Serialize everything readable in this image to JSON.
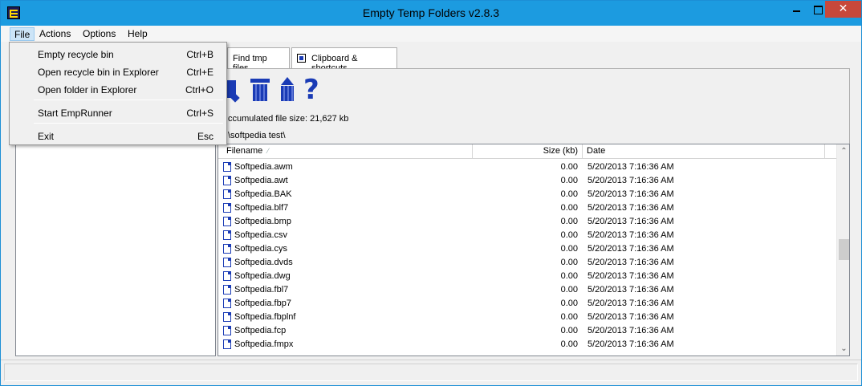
{
  "window": {
    "title": "Empty Temp Folders v2.8.3",
    "close_glyph": "✕",
    "accent_color": "#1c9be0",
    "close_color": "#c7483b"
  },
  "menubar": {
    "file": "File",
    "actions": "Actions",
    "options": "Options",
    "help": "Help"
  },
  "file_menu": {
    "items": [
      {
        "label": "Empty recycle bin",
        "shortcut": "Ctrl+B"
      },
      {
        "label": "Open recycle bin in Explorer",
        "shortcut": "Ctrl+E"
      },
      {
        "label": "Open folder in Explorer",
        "shortcut": "Ctrl+O"
      },
      {
        "label": "Start EmpRunner",
        "shortcut": "Ctrl+S"
      },
      {
        "label": "Exit",
        "shortcut": "Esc"
      }
    ]
  },
  "tabs": {
    "find": "Find tmp files",
    "clipboard": "Clipboard & shortcuts"
  },
  "toolbar": {
    "help_glyph": "?",
    "icons": [
      "find-icon",
      "trash-icon",
      "upload-icon",
      "help-icon"
    ]
  },
  "info": {
    "accumulated": "ccumulated file size: 21,627 kb",
    "path": "\\softpedia test\\"
  },
  "list": {
    "headers": {
      "name": "Filename",
      "size": "Size (kb)",
      "date": "Date",
      "sort_glyph": "⁄"
    },
    "rows": [
      {
        "name": "Softpedia.awm",
        "size": "0.00",
        "date": "5/20/2013 7:16:36 AM"
      },
      {
        "name": "Softpedia.awt",
        "size": "0.00",
        "date": "5/20/2013 7:16:36 AM"
      },
      {
        "name": "Softpedia.BAK",
        "size": "0.00",
        "date": "5/20/2013 7:16:36 AM"
      },
      {
        "name": "Softpedia.blf7",
        "size": "0.00",
        "date": "5/20/2013 7:16:36 AM"
      },
      {
        "name": "Softpedia.bmp",
        "size": "0.00",
        "date": "5/20/2013 7:16:36 AM"
      },
      {
        "name": "Softpedia.csv",
        "size": "0.00",
        "date": "5/20/2013 7:16:36 AM"
      },
      {
        "name": "Softpedia.cys",
        "size": "0.00",
        "date": "5/20/2013 7:16:36 AM"
      },
      {
        "name": "Softpedia.dvds",
        "size": "0.00",
        "date": "5/20/2013 7:16:36 AM"
      },
      {
        "name": "Softpedia.dwg",
        "size": "0.00",
        "date": "5/20/2013 7:16:36 AM"
      },
      {
        "name": "Softpedia.fbl7",
        "size": "0.00",
        "date": "5/20/2013 7:16:36 AM"
      },
      {
        "name": "Softpedia.fbp7",
        "size": "0.00",
        "date": "5/20/2013 7:16:36 AM"
      },
      {
        "name": "Softpedia.fbplnf",
        "size": "0.00",
        "date": "5/20/2013 7:16:36 AM"
      },
      {
        "name": "Softpedia.fcp",
        "size": "0.00",
        "date": "5/20/2013 7:16:36 AM"
      },
      {
        "name": "Softpedia.fmpx",
        "size": "0.00",
        "date": "5/20/2013 7:16:36 AM"
      }
    ],
    "scroll_up": "⌃",
    "scroll_down": "⌄"
  }
}
